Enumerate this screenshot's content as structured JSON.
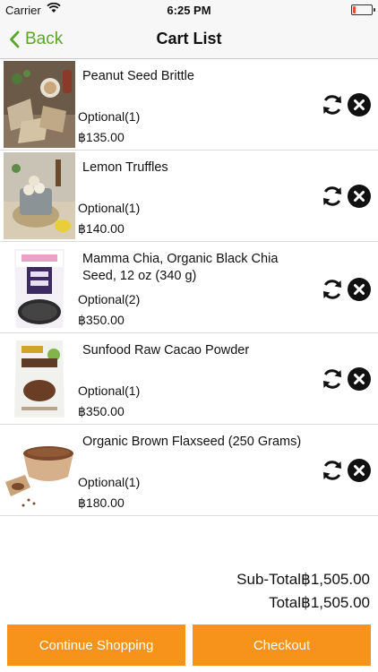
{
  "status_bar": {
    "carrier": "Carrier",
    "time": "6:25 PM",
    "battery_level": 0.15,
    "icons": [
      "wifi-icon",
      "battery-icon"
    ]
  },
  "nav": {
    "back_label": "Back",
    "title": "Cart List",
    "accent_color": "#5aa62b"
  },
  "items": [
    {
      "name": "Peanut Seed Brittle",
      "option": "Optional(1)",
      "price": "฿135.00",
      "image": "peanut-brittle-photo"
    },
    {
      "name": "Lemon Truffles",
      "option": "Optional(1)",
      "price": "฿140.00",
      "image": "lemon-truffles-photo"
    },
    {
      "name": "Mamma Chia, Organic Black Chia Seed, 12 oz (340 g)",
      "option": "Optional(2)",
      "price": "฿350.00",
      "image": "chia-seed-bag-photo"
    },
    {
      "name": "Sunfood Raw Cacao Powder",
      "option": "Optional(1)",
      "price": "฿350.00",
      "image": "cacao-powder-bag-photo"
    },
    {
      "name": "Organic Brown Flaxseed (250 Grams)",
      "option": "Optional(1)",
      "price": "฿180.00",
      "image": "flaxseed-bowl-photo"
    }
  ],
  "row_actions": {
    "refresh_icon": "refresh-icon",
    "remove_icon": "close-icon"
  },
  "totals": {
    "subtotal_label": "Sub-Total",
    "subtotal_value": "฿1,505.00",
    "total_label": "Total",
    "total_value": "฿1,505.00"
  },
  "footer": {
    "continue_label": "Continue Shopping",
    "checkout_label": "Checkout",
    "button_color": "#f7931a"
  }
}
